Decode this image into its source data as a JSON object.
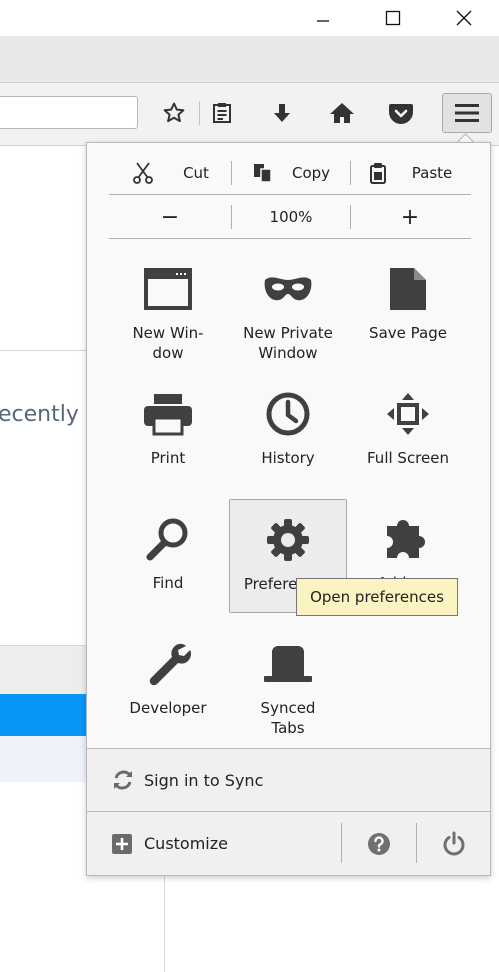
{
  "window": {
    "minimize_icon": "minimize-icon",
    "maximize_icon": "maximize-icon",
    "close_icon": "close-icon"
  },
  "toolbar": {
    "icons": [
      "star-icon",
      "reading-list-icon",
      "download-icon",
      "home-icon",
      "pocket-icon",
      "hamburger-menu-icon"
    ]
  },
  "page": {
    "partial_text": "ecently"
  },
  "panel": {
    "edit": {
      "cut": "Cut",
      "copy": "Copy",
      "paste": "Paste"
    },
    "zoom": {
      "out": "−",
      "level": "100%",
      "in": "+"
    },
    "tiles": [
      {
        "label": "New Win-dow",
        "label_line1": "New Win-",
        "label_line2": "dow",
        "icon": "new-window-icon"
      },
      {
        "label": "New Private Window",
        "label_line1": "New Private",
        "label_line2": "Window",
        "icon": "private-mask-icon"
      },
      {
        "label": "Save Page",
        "label_line1": "Save Page",
        "label_line2": "",
        "icon": "save-page-icon"
      },
      {
        "label": "Print",
        "label_line1": "Print",
        "label_line2": "",
        "icon": "printer-icon"
      },
      {
        "label": "History",
        "label_line1": "History",
        "label_line2": "",
        "icon": "clock-icon"
      },
      {
        "label": "Full Screen",
        "label_line1": "Full Screen",
        "label_line2": "",
        "icon": "fullscreen-icon"
      },
      {
        "label": "Find",
        "label_line1": "Find",
        "label_line2": "",
        "icon": "magnifier-icon"
      },
      {
        "label": "Preferences",
        "label_line1": "Preferences",
        "label_line2": "",
        "icon": "gear-icon"
      },
      {
        "label": "Add-ons",
        "label_line1": "Add-ons",
        "label_line2": "",
        "icon": "puzzle-icon"
      },
      {
        "label": "Developer",
        "label_line1": "Developer",
        "label_line2": "",
        "icon": "wrench-icon"
      },
      {
        "label": "Synced Tabs",
        "label_line1": "Synced",
        "label_line2": "Tabs",
        "icon": "synced-tabs-icon"
      }
    ],
    "sync": "Sign in to Sync",
    "customize": "Customize",
    "footer_icons": [
      "help-icon",
      "power-icon"
    ]
  },
  "tooltip": "Open preferences",
  "colors": {
    "accent_blue": "#0996f8",
    "tooltip_bg": "#fbf3c2",
    "icon_dark": "#404040"
  }
}
